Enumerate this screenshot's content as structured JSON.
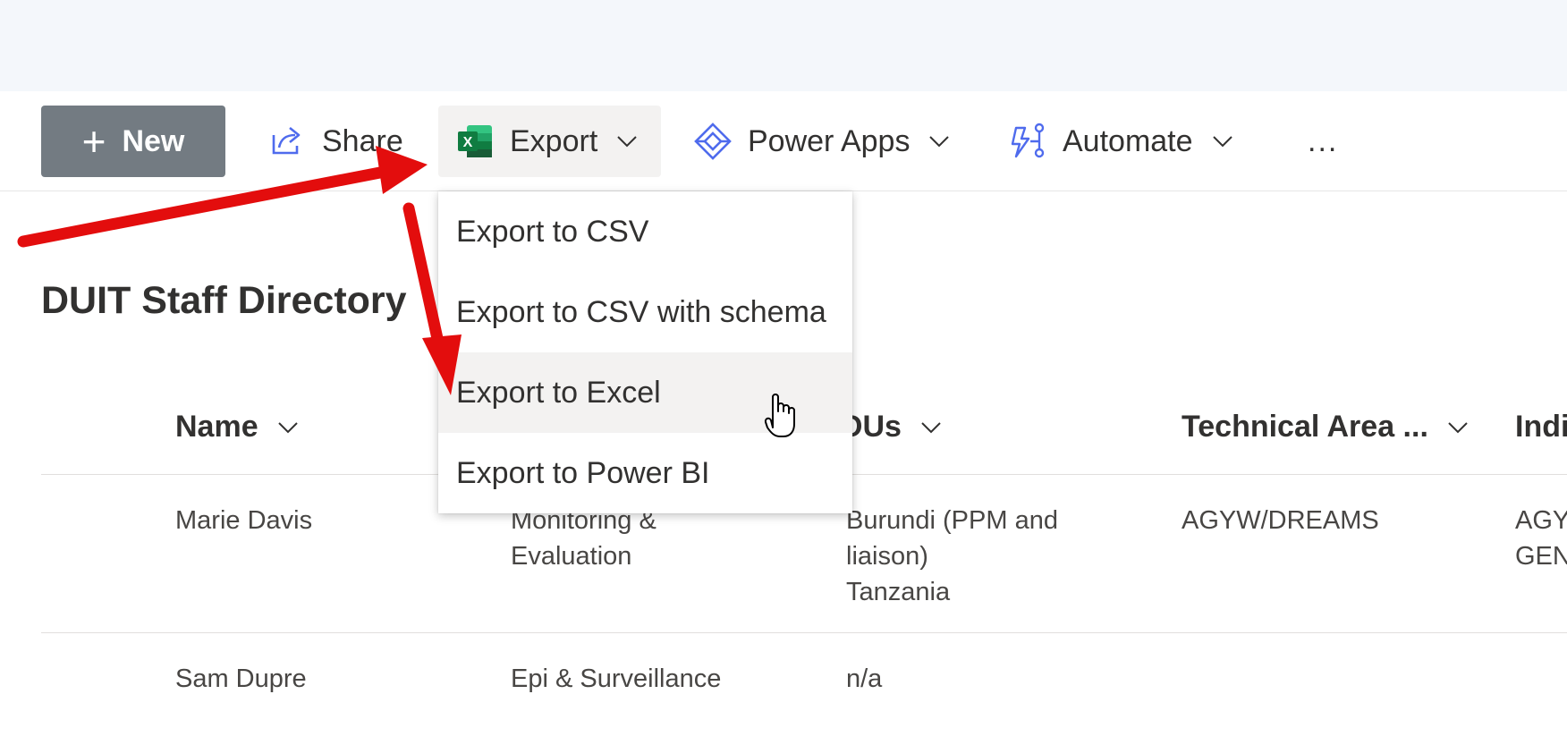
{
  "toolbar": {
    "new_label": "New",
    "share_label": "Share",
    "export_label": "Export",
    "powerapps_label": "Power Apps",
    "automate_label": "Automate",
    "more_label": "..."
  },
  "export_menu": {
    "items": [
      {
        "label": "Export to CSV"
      },
      {
        "label": "Export to CSV with schema"
      },
      {
        "label": "Export to Excel",
        "hovered": true
      },
      {
        "label": "Export to Power BI"
      }
    ]
  },
  "page": {
    "title": "DUIT Staff Directory"
  },
  "table": {
    "columns": [
      {
        "label": "Name"
      },
      {
        "label": "OUs"
      },
      {
        "label": "Technical Area ..."
      },
      {
        "label": "Indi"
      }
    ],
    "rows": [
      {
        "name": "Marie Davis",
        "role": [
          "Monitoring &",
          "Evaluation"
        ],
        "ous": [
          "Burundi (PPM and",
          "liaison)",
          "Tanzania"
        ],
        "technical_area": "AGYW/DREAMS",
        "indi": [
          "AGY",
          "GEN"
        ]
      },
      {
        "name": "Sam Dupre",
        "role": [
          "Epi & Surveillance"
        ],
        "ous": [
          "n/a"
        ],
        "technical_area": "",
        "indi": []
      }
    ]
  },
  "colors": {
    "new_button_bg": "#737b82",
    "hover_bg": "#f3f2f1",
    "annotation_arrow": "#e30d0d",
    "excel_green": "#217346",
    "icon_blue": "#4f6bed"
  },
  "icons": [
    "plus-icon",
    "share-icon",
    "excel-icon",
    "power-apps-icon",
    "automate-icon",
    "chevron-down-icon",
    "hand-cursor-icon"
  ]
}
